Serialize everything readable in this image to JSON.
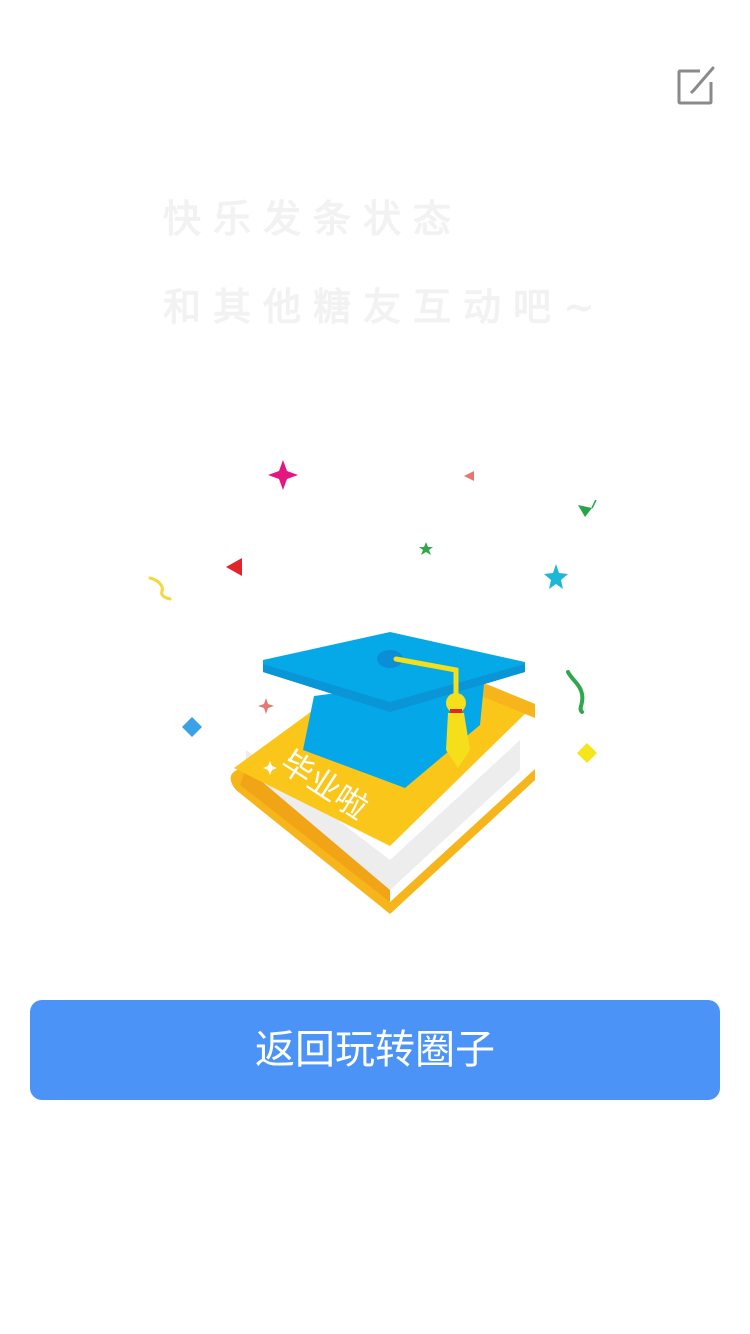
{
  "header": {
    "edit_icon": "edit-compose-icon"
  },
  "empty_state": {
    "line1": "快乐发条状态",
    "line2": "和其他糖友互动吧~",
    "illustration_icon": "graduation-cap-book-illustration",
    "book_label": "毕业啦"
  },
  "actions": {
    "return_label": "返回玩转圈子",
    "button_color": "#4c93f8"
  }
}
